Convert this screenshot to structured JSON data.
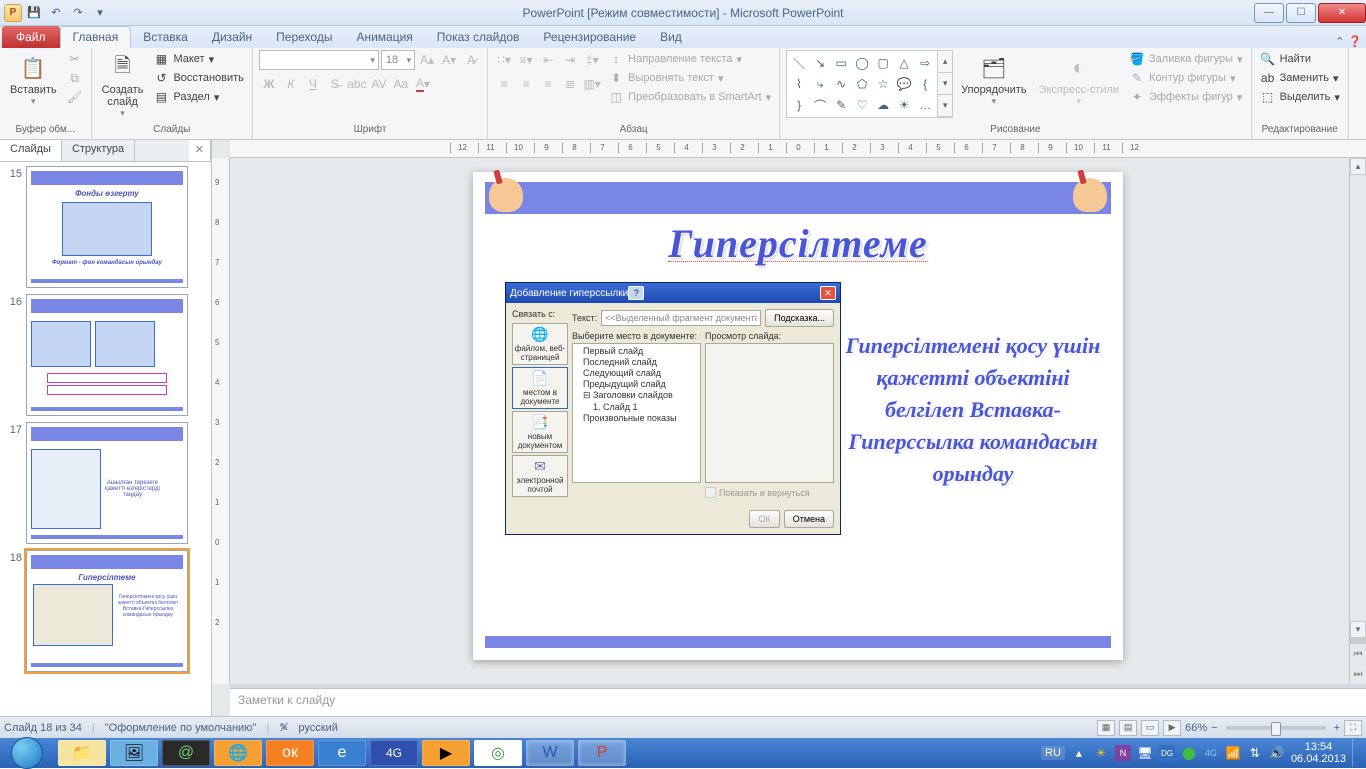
{
  "title": "PowerPoint [Режим совместимости]  -  Microsoft PowerPoint",
  "ribbon": {
    "file": "Файл",
    "tabs": [
      "Главная",
      "Вставка",
      "Дизайн",
      "Переходы",
      "Анимация",
      "Показ слайдов",
      "Рецензирование",
      "Вид"
    ],
    "active": 0,
    "groups": {
      "clipboard": {
        "label": "Буфер обм...",
        "paste": "Вставить"
      },
      "slides": {
        "label": "Слайды",
        "new_slide": "Создать\nслайд",
        "layout": "Макет",
        "reset": "Восстановить",
        "section": "Раздел"
      },
      "font": {
        "label": "Шрифт",
        "size": "18"
      },
      "para": {
        "label": "Абзац",
        "dir": "Направление текста",
        "align": "Выровнять текст",
        "smartart": "Преобразовать в SmartArt"
      },
      "drawing": {
        "label": "Рисование",
        "arrange": "Упорядочить",
        "styles": "Экспресс-стили",
        "fill": "Заливка фигуры",
        "outline": "Контур фигуры",
        "effects": "Эффекты фигур"
      },
      "editing": {
        "label": "Редактирование",
        "find": "Найти",
        "replace": "Заменить",
        "select": "Выделить"
      }
    }
  },
  "slide_tabs": {
    "slides": "Слайды",
    "outline": "Структура"
  },
  "thumbs": [
    {
      "num": 15,
      "title": "Фонды өзгерту",
      "sub": "Формат - фон\nкомандасын орындау"
    },
    {
      "num": 16,
      "title": ""
    },
    {
      "num": 17,
      "title": "",
      "text": "Ашылған терезеге\nқажетті өзгерістерді\nтаңдау"
    },
    {
      "num": 18,
      "title": "Гиперсілтеме",
      "selected": true
    }
  ],
  "slide": {
    "wordart": "Гиперсілтеме",
    "side_text": "Гиперсілтемені қосу үшін қажетті объектіні белгілеп Вставка-Гиперссылка командасын орындау",
    "dialog": {
      "title": "Добавление гиперссылки",
      "link_label": "Связать с:",
      "text_label": "Текст:",
      "text_value": "<<Выделенный фрагмент документа>>",
      "hint_btn": "Подсказка...",
      "left_buttons": [
        {
          "icon": "🌐",
          "label": "файлом, веб-\nстраницей"
        },
        {
          "icon": "📄",
          "label": "местом в\nдокументе"
        },
        {
          "icon": "📑",
          "label": "новым\nдокументом"
        },
        {
          "icon": "✉",
          "label": "электронной\nпочтой"
        }
      ],
      "tree_label": "Выберите место в документе:",
      "preview_label": "Просмотр слайда:",
      "tree": [
        "Первый слайд",
        "Последний слайд",
        "Следующий слайд",
        "Предыдущий слайд",
        "Заголовки слайдов",
        "1. Слайд 1",
        "Произвольные показы"
      ],
      "checkbox": "Показать и вернуться",
      "ok": "ОК",
      "cancel": "Отмена"
    }
  },
  "notes_placeholder": "Заметки к слайду",
  "status": {
    "slide": "Слайд 18 из 34",
    "theme": "\"Оформление по умолчанию\"",
    "lang": "русский",
    "zoom": "66%"
  },
  "tray": {
    "lang": "RU",
    "time": "13:54",
    "date": "06.04.2013"
  },
  "ruler_marks": [
    "12",
    "11",
    "10",
    "9",
    "8",
    "7",
    "6",
    "5",
    "4",
    "3",
    "2",
    "1",
    "0",
    "1",
    "2",
    "3",
    "4",
    "5",
    "6",
    "7",
    "8",
    "9",
    "10",
    "11",
    "12"
  ]
}
